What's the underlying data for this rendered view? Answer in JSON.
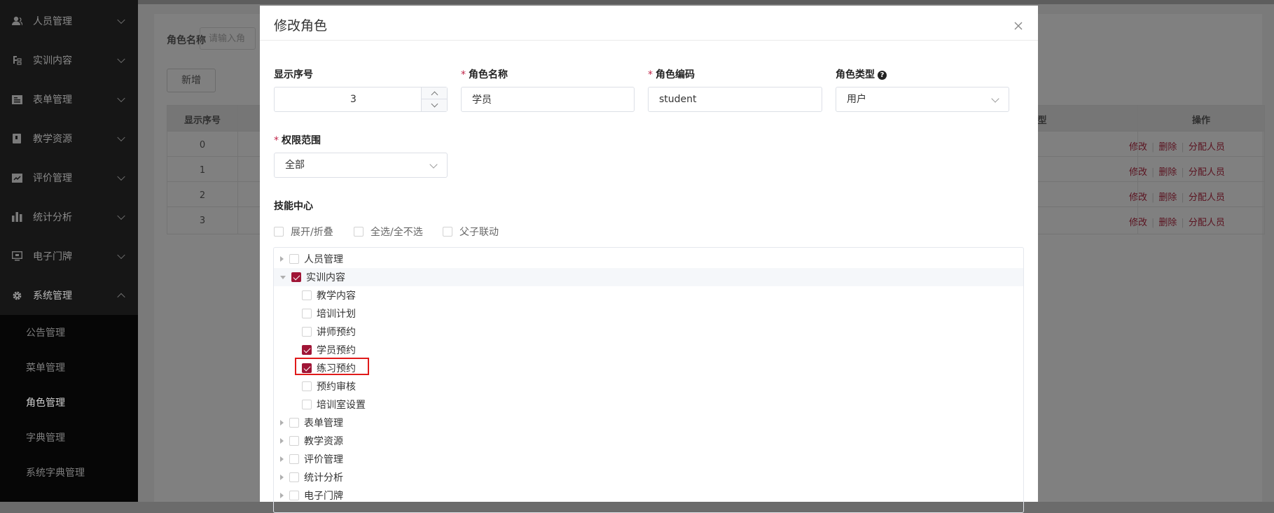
{
  "sidebar": {
    "items": [
      {
        "label": "人员管理",
        "icon": "user-icon"
      },
      {
        "label": "实训内容",
        "icon": "training-icon"
      },
      {
        "label": "表单管理",
        "icon": "form-icon"
      },
      {
        "label": "教学资源",
        "icon": "book-icon"
      },
      {
        "label": "评价管理",
        "icon": "evaluation-icon"
      },
      {
        "label": "统计分析",
        "icon": "bar-chart-icon"
      },
      {
        "label": "电子门牌",
        "icon": "monitor-icon"
      },
      {
        "label": "系统管理",
        "icon": "gear-icon"
      }
    ],
    "subitems": [
      "公告管理",
      "菜单管理",
      "角色管理",
      "字典管理",
      "系统字典管理"
    ],
    "active_sub": "角色管理"
  },
  "background": {
    "search_label": "角色名称",
    "search_placeholder": "请输入角",
    "add_button": "新增",
    "table": {
      "headers": [
        "显示序号",
        "型",
        "操作"
      ],
      "rows": [
        "0",
        "1",
        "2",
        "3"
      ],
      "ops": [
        "修改",
        "删除",
        "分配人员"
      ]
    }
  },
  "modal": {
    "title": "修改角色",
    "fields": {
      "order": {
        "label": "显示序号",
        "value": "3"
      },
      "name": {
        "label": "角色名称",
        "value": "学员",
        "required": "*"
      },
      "code": {
        "label": "角色编码",
        "value": "student",
        "required": "*"
      },
      "type": {
        "label": "角色类型",
        "value": "用户",
        "help": "?"
      },
      "scope": {
        "label": "权限范围",
        "value": "全部",
        "required": "*"
      }
    },
    "skill_center": {
      "label": "技能中心",
      "options": [
        "展开/折叠",
        "全选/全不选",
        "父子联动"
      ]
    },
    "tree": [
      {
        "label": "人员管理",
        "level": 0,
        "checked": false,
        "expanded": false
      },
      {
        "label": "实训内容",
        "level": 0,
        "checked": true,
        "expanded": true
      },
      {
        "label": "教学内容",
        "level": 1,
        "checked": false
      },
      {
        "label": "培训计划",
        "level": 1,
        "checked": false
      },
      {
        "label": "讲师预约",
        "level": 1,
        "checked": false
      },
      {
        "label": "学员预约",
        "level": 1,
        "checked": true
      },
      {
        "label": "练习预约",
        "level": 1,
        "checked": true
      },
      {
        "label": "预约审核",
        "level": 1,
        "checked": false
      },
      {
        "label": "培训室设置",
        "level": 1,
        "checked": false
      },
      {
        "label": "表单管理",
        "level": 0,
        "checked": false,
        "expanded": false
      },
      {
        "label": "教学资源",
        "level": 0,
        "checked": false,
        "expanded": false
      },
      {
        "label": "评价管理",
        "level": 0,
        "checked": false,
        "expanded": false
      },
      {
        "label": "统计分析",
        "level": 0,
        "checked": false,
        "expanded": false
      },
      {
        "label": "电子门牌",
        "level": 0,
        "checked": false,
        "expanded": false
      }
    ]
  },
  "colors": {
    "accent": "#a01536",
    "sidebar": "#161616",
    "highlight_box": "#e01a1a"
  }
}
